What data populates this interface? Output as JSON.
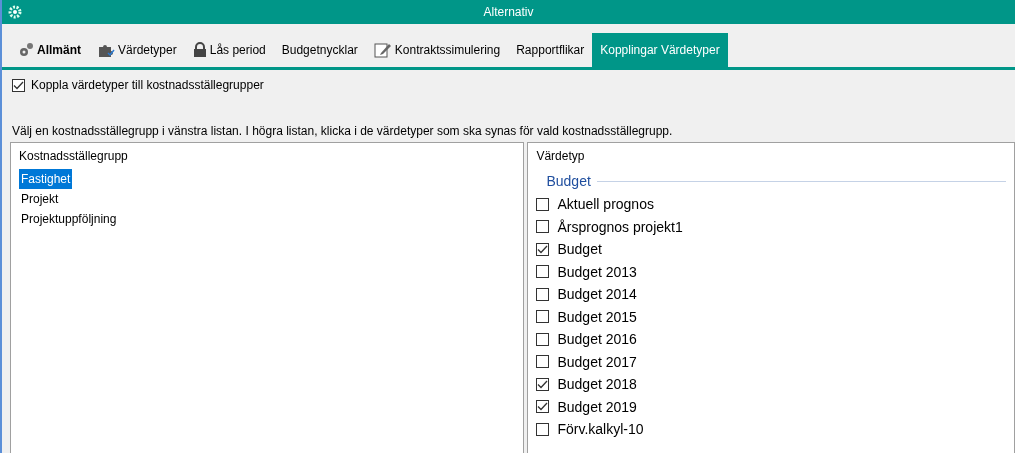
{
  "window": {
    "title": "Alternativ"
  },
  "tabs": [
    {
      "label": "Allmänt",
      "selected": false
    },
    {
      "label": "Värdetyper",
      "selected": false
    },
    {
      "label": "Lås period",
      "selected": false
    },
    {
      "label": "Budgetnycklar",
      "selected": false
    },
    {
      "label": "Kontraktssimulering",
      "selected": false
    },
    {
      "label": "Rapportflikar",
      "selected": false
    },
    {
      "label": "Kopplingar Värdetyper",
      "selected": true
    }
  ],
  "link_option": {
    "label": "Koppla värdetyper till kostnadsställegrupper",
    "checked": true
  },
  "instruction": "Välj en kostnadsställegrupp i vänstra listan. I högra listan, klicka i de värdetyper som ska synas för vald kostnadsställegrupp.",
  "left_list": {
    "header": "Kostnadsställegrupp",
    "items": [
      {
        "label": "Fastighet",
        "selected": true
      },
      {
        "label": "Projekt",
        "selected": false
      },
      {
        "label": "Projektuppföljning",
        "selected": false
      }
    ]
  },
  "right_list": {
    "header": "Värdetyp",
    "group": "Budget",
    "items": [
      {
        "label": "Aktuell prognos",
        "checked": false
      },
      {
        "label": "Årsprognos projekt1",
        "checked": false
      },
      {
        "label": "Budget",
        "checked": true
      },
      {
        "label": "Budget 2013",
        "checked": false
      },
      {
        "label": "Budget 2014",
        "checked": false
      },
      {
        "label": "Budget 2015",
        "checked": false
      },
      {
        "label": "Budget 2016",
        "checked": false
      },
      {
        "label": "Budget 2017",
        "checked": false
      },
      {
        "label": "Budget 2018",
        "checked": true
      },
      {
        "label": "Budget 2019",
        "checked": true
      },
      {
        "label": "Förv.kalkyl-10",
        "checked": false
      }
    ]
  }
}
